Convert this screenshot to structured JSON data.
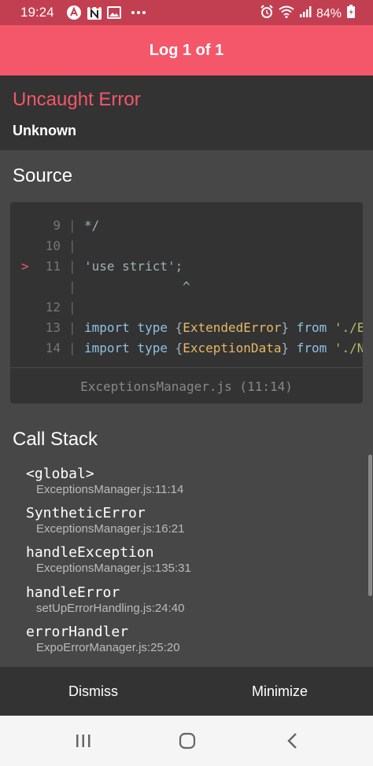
{
  "status_bar": {
    "time": "19:24",
    "battery": "84%",
    "icons": [
      "notification-a-icon",
      "notification-n-icon",
      "image-icon",
      "more-icon",
      "alarm-icon",
      "wifi-icon",
      "signal-icon",
      "battery-icon"
    ]
  },
  "header": {
    "title": "Log 1 of 1"
  },
  "error": {
    "title": "Uncaught Error",
    "message": "Unknown"
  },
  "source": {
    "title": "Source",
    "lines": [
      {
        "num": "9",
        "marker": "",
        "code": " */"
      },
      {
        "num": "10",
        "marker": "",
        "code": ""
      },
      {
        "num": "11",
        "marker": ">",
        "code": "'use strict';"
      },
      {
        "num": "",
        "marker": "",
        "code": "^"
      },
      {
        "num": "12",
        "marker": "",
        "code": ""
      },
      {
        "num": "13",
        "marker": "",
        "code": "import type {ExtendedError} from './E"
      },
      {
        "num": "14",
        "marker": "",
        "code": "import type {ExceptionData} from './N"
      }
    ],
    "file": "ExceptionsManager.js (11:14)"
  },
  "call_stack": {
    "title": "Call Stack",
    "frames": [
      {
        "fn": "<global>",
        "loc": "ExceptionsManager.js:11:14"
      },
      {
        "fn": "SyntheticError",
        "loc": "ExceptionsManager.js:16:21"
      },
      {
        "fn": "handleException",
        "loc": "ExceptionsManager.js:135:31"
      },
      {
        "fn": "handleError",
        "loc": "setUpErrorHandling.js:24:40"
      },
      {
        "fn": "errorHandler",
        "loc": "ExpoErrorManager.js:25:20"
      }
    ]
  },
  "actions": {
    "dismiss": "Dismiss",
    "minimize": "Minimize"
  },
  "colors": {
    "accent": "#f35769",
    "panel": "#333333",
    "background": "#474747"
  }
}
